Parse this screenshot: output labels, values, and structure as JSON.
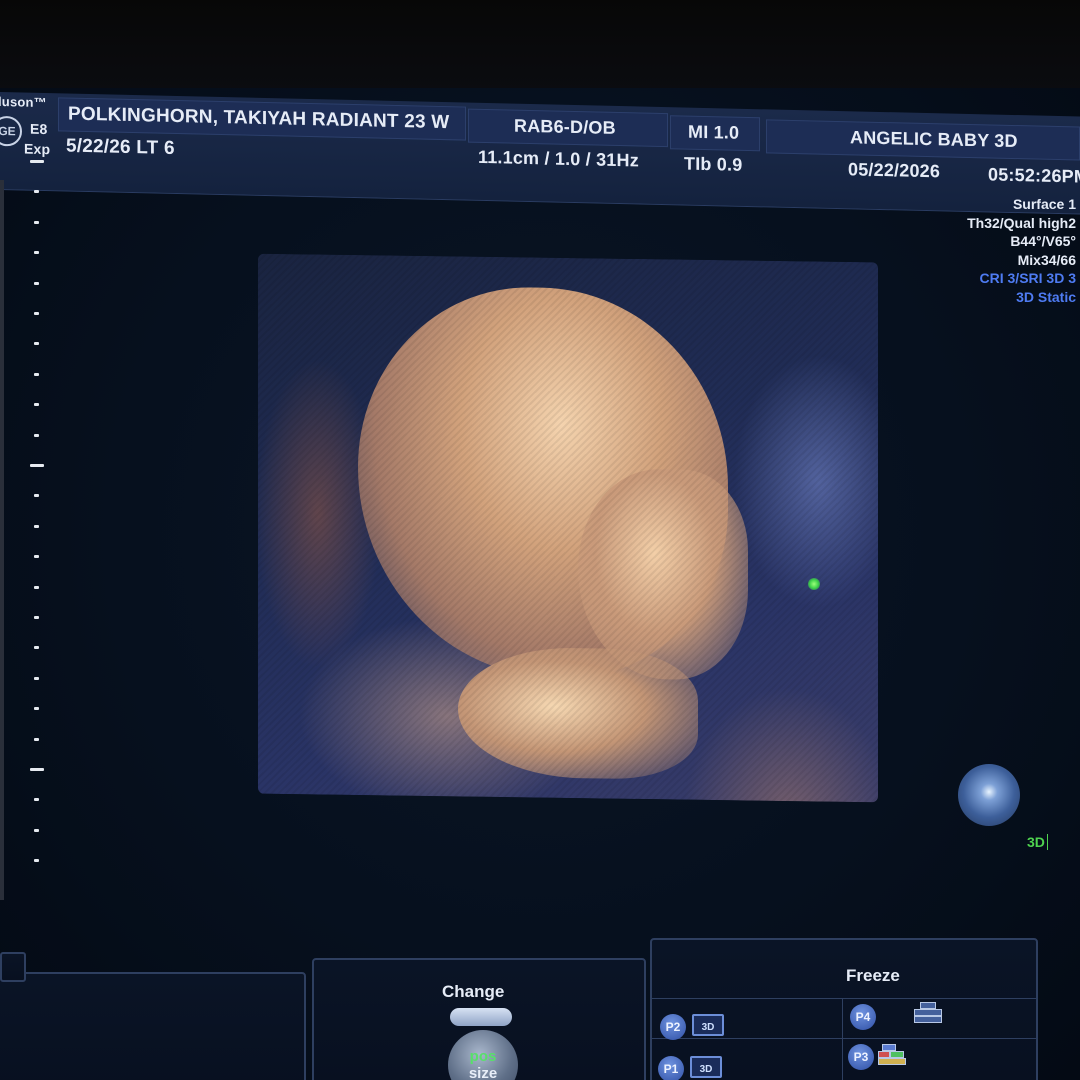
{
  "header": {
    "logo_brand": "luson™",
    "logo_model": "E8",
    "logo_mode": "Exp",
    "patient_name": "POLKINGHORN, TAKIYAH RADIANT 23 W",
    "lmp": "5/22/26 LT 6",
    "probe": "RAB6-D/OB",
    "depth_freq": "11.1cm / 1.0 / 31Hz",
    "mi": "MI  1.0",
    "tib": "TIb  0.9",
    "facility": "ANGELIC BABY 3D",
    "date": "05/22/2026",
    "time": "05:52:26PM"
  },
  "info_panel": [
    {
      "text": "Surface 1",
      "color": "#e6ecf7"
    },
    {
      "text": "Th32/Qual high2",
      "color": "#e6ecf7"
    },
    {
      "text": "B44°/V65°",
      "color": "#e6ecf7"
    },
    {
      "text": "Mix34/66",
      "color": "#e6ecf7"
    },
    {
      "text": "CRI 3/SRI 3D 3",
      "color": "#4e7bf2"
    },
    {
      "text": "3D Static",
      "color": "#4e7bf2"
    }
  ],
  "view_tag": "3D",
  "controls": {
    "change_label": "Change",
    "knob_pos": "pos",
    "knob_size": "size",
    "freeze_label": "Freeze",
    "presets": [
      {
        "id": "P2",
        "icon": "3D",
        "icon_name": "3d-volume-icon"
      },
      {
        "id": "P4",
        "icon": "",
        "icon_name": "stack-layout-icon"
      },
      {
        "id": "P1",
        "icon": "3D",
        "icon_name": "3d-volume-icon"
      },
      {
        "id": "P3",
        "icon": "",
        "icon_name": "color-stack-icon"
      }
    ]
  },
  "colors": {
    "header_bg": "#1b2a4a",
    "accent_blue": "#4e7bf2",
    "accent_green": "#4fd34f"
  }
}
